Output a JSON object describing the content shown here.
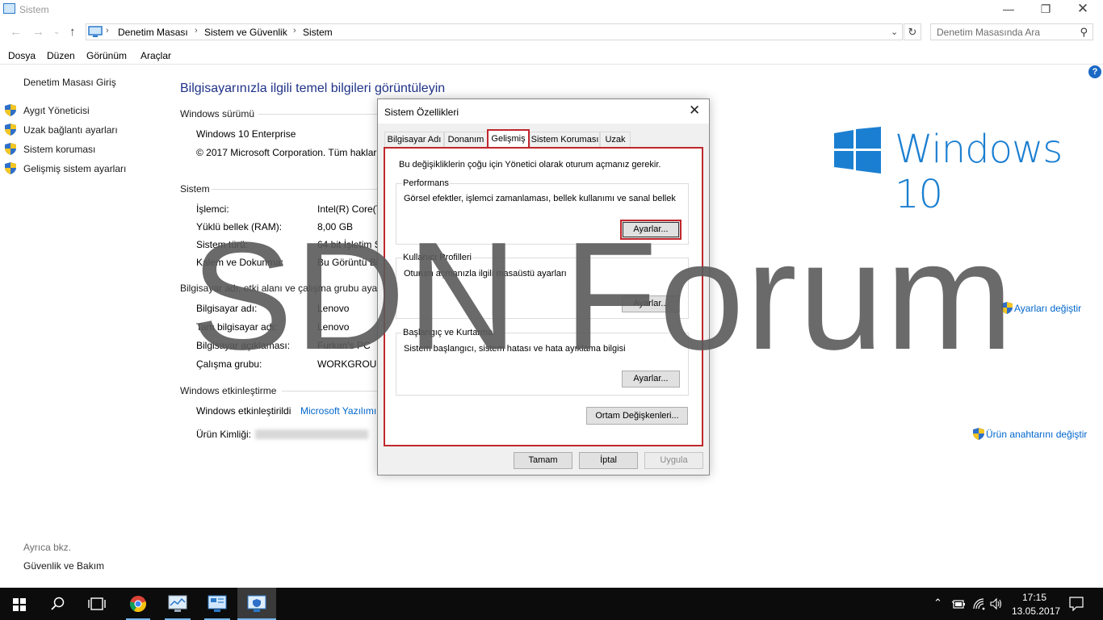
{
  "window": {
    "title": "Sistem"
  },
  "address": {
    "crumbs": [
      "Denetim Masası",
      "Sistem ve Güvenlik",
      "Sistem"
    ],
    "search_placeholder": "Denetim Masasında Ara"
  },
  "menu": [
    "Dosya",
    "Düzen",
    "Görünüm",
    "Araçlar"
  ],
  "sidebar": {
    "home": "Denetim Masası Giriş",
    "items": [
      {
        "label": "Aygıt Yöneticisi",
        "icon": "shield-icon"
      },
      {
        "label": "Uzak bağlantı ayarları",
        "icon": "shield-icon"
      },
      {
        "label": "Sistem koruması",
        "icon": "shield-icon"
      },
      {
        "label": "Gelişmiş sistem ayarları",
        "icon": "shield-icon"
      }
    ],
    "see_also": "Ayrıca bkz.",
    "security": "Güvenlik ve Bakım"
  },
  "main": {
    "heading": "Bilgisayarınızla ilgili temel bilgileri görüntüleyin",
    "edition": {
      "title": "Windows sürümü",
      "name": "Windows 10 Enterprise",
      "copyright": "© 2017 Microsoft Corporation. Tüm haklar"
    },
    "system": {
      "title": "Sistem",
      "rows": [
        {
          "label": "İşlemci:",
          "value": "Intel(R) Core(T"
        },
        {
          "label": "Yüklü bellek (RAM):",
          "value": "8,00 GB"
        },
        {
          "label": "Sistem türü:",
          "value": "64 bit İşletim S"
        },
        {
          "label": "Kalem ve Dokunma:",
          "value": "Bu Görüntü Bi"
        }
      ]
    },
    "computer": {
      "title": "Bilgisayar adı, etki alanı ve çalışma grubu ayar",
      "rows": [
        {
          "label": "Bilgisayar adı:",
          "value": "Lenovo"
        },
        {
          "label": "Tam bilgisayar adı:",
          "value": "Lenovo"
        },
        {
          "label": "Bilgisayar açıklaması:",
          "value": "Furkan's PC"
        },
        {
          "label": "Çalışma grubu:",
          "value": "WORKGROUP"
        }
      ],
      "change_link": "Ayarları değiştir"
    },
    "activation": {
      "title": "Windows etkinleştirme",
      "status_label": "Windows etkinleştirildi",
      "status_link": "Microsoft Yazılımı",
      "product_label": "Ürün Kimliği:",
      "key_link": "Ürün anahtarını değiştir"
    },
    "logo_text": "Windows 10"
  },
  "dialog": {
    "title": "Sistem Özellikleri",
    "tabs": [
      "Bilgisayar Adı",
      "Donanım",
      "Gelişmiş",
      "Sistem Koruması",
      "Uzak"
    ],
    "active_tab": "Gelişmiş",
    "notice": "Bu değişikliklerin çoğu için Yönetici olarak oturum açmanız gerekir.",
    "performance": {
      "title": "Performans",
      "desc": "Görsel efektler, işlemci zamanlaması, bellek kullanımı ve sanal bellek",
      "button": "Ayarlar..."
    },
    "profiles": {
      "title": "Kullanıcı Profilleri",
      "desc": "Oturum açmanızla ilgili masaüstü ayarları",
      "button": "Ayarlar..."
    },
    "startup": {
      "title": "Başlangıç ve Kurtarma",
      "desc": "Sistem başlangıcı, sistem hatası ve hata ayıklama bilgisi",
      "button": "Ayarlar..."
    },
    "env_button": "Ortam Değişkenleri...",
    "ok": "Tamam",
    "cancel": "İptal",
    "apply": "Uygula"
  },
  "watermark": "SDN Forum",
  "taskbar": {
    "time": "17:15",
    "date": "13.05.2017"
  },
  "colors": {
    "accent": "#1e3287",
    "link": "#0066cc",
    "highlight": "#c1272d",
    "windows_blue": "#1b7fd1"
  }
}
